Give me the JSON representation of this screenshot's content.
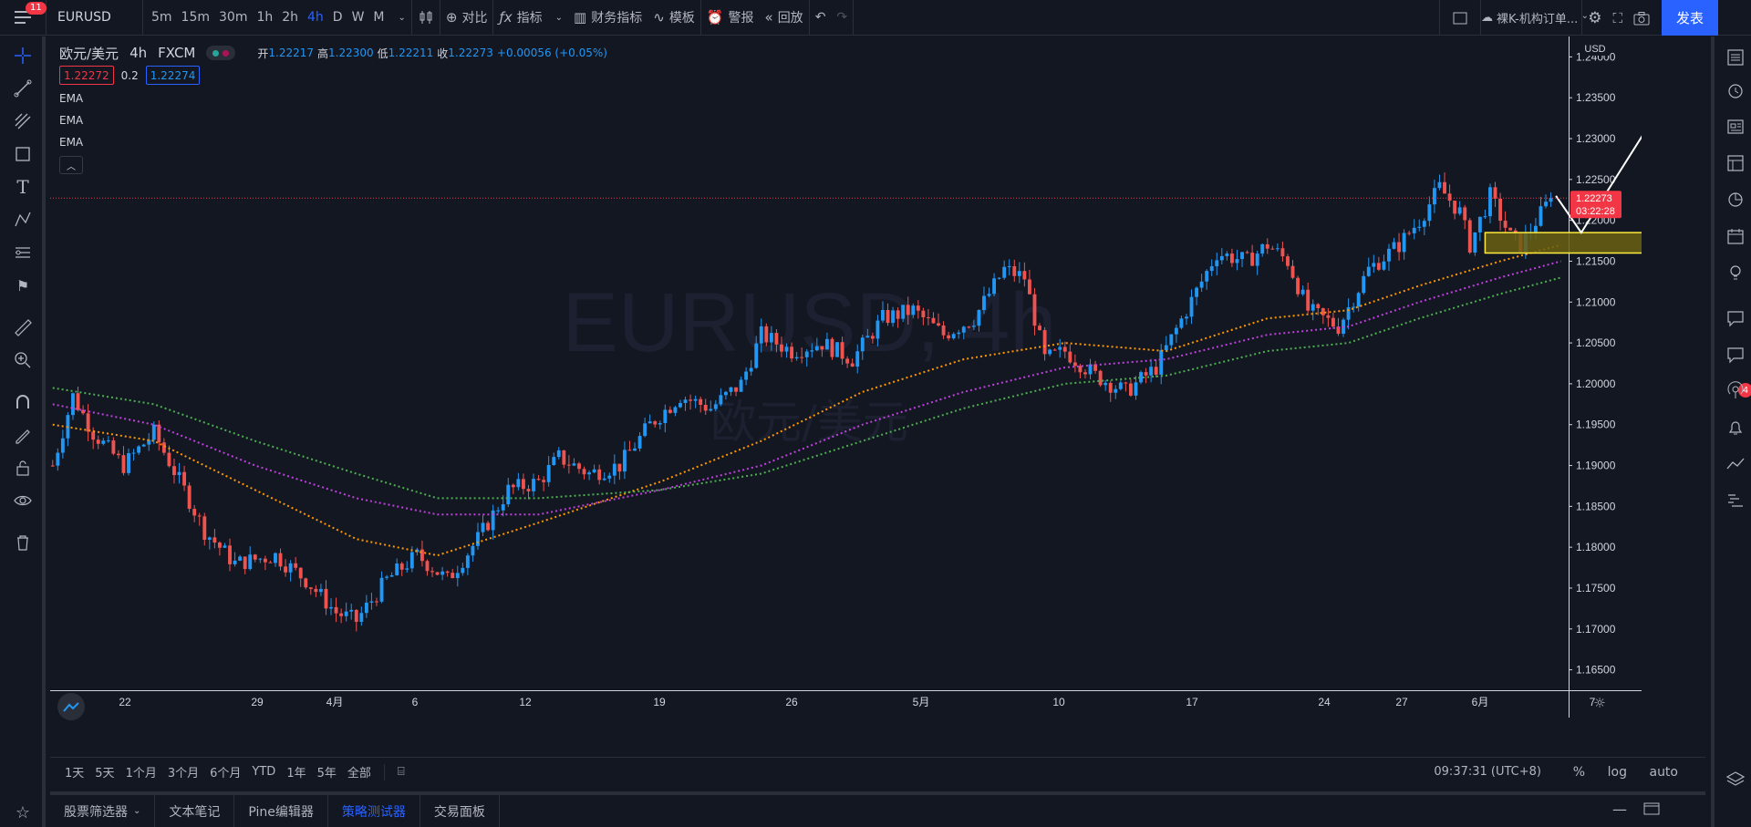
{
  "topbar": {
    "menu_badge": "11",
    "symbol": "EURUSD",
    "intervals": [
      "5m",
      "15m",
      "30m",
      "1h",
      "2h",
      "4h",
      "D",
      "W",
      "M"
    ],
    "active_interval": "4h",
    "compare_label": "对比",
    "indicators_label": "指标",
    "financials_label": "财务指标",
    "templates_label": "模板",
    "alert_label": "警报",
    "replay_label": "回放",
    "layout_name": "裸K-机构订单...",
    "publish_label": "发表"
  },
  "legend": {
    "title": "欧元/美元",
    "interval": "4h",
    "exchange": "FXCM",
    "open_label": "开",
    "open": "1.22217",
    "high_label": "高",
    "high": "1.22300",
    "low_label": "低",
    "low": "1.22211",
    "close_label": "收",
    "close": "1.22273",
    "change": "+0.00056 (+0.05%)",
    "bid": "1.22272",
    "spread": "0.2",
    "ask": "1.22274",
    "indicators": [
      "EMA",
      "EMA",
      "EMA"
    ]
  },
  "watermark": {
    "symbol": "EURUSD, 4h",
    "description": "欧元/美元"
  },
  "price_axis": {
    "currency": "USD",
    "ticks": [
      "1.24000",
      "1.23500",
      "1.23000",
      "1.22500",
      "1.22000",
      "1.21500",
      "1.21000",
      "1.20500",
      "1.20000",
      "1.19500",
      "1.19000",
      "1.18500",
      "1.18000",
      "1.17500",
      "1.17000",
      "1.16500"
    ],
    "last_price": "1.22273",
    "countdown": "03:22:28"
  },
  "time_axis": {
    "ticks": [
      "22",
      "29",
      "4月",
      "6",
      "12",
      "19",
      "26",
      "5月",
      "10",
      "17",
      "24",
      "27",
      "6月",
      "7"
    ]
  },
  "range_bar": {
    "ranges": [
      "1天",
      "5天",
      "1个月",
      "3个月",
      "6个月",
      "YTD",
      "1年",
      "5年",
      "全部"
    ],
    "time": "09:37:31 (UTC+8)",
    "percent": "%",
    "log": "log",
    "auto": "auto"
  },
  "bottom_tabs": [
    "股票筛选器",
    "文本笔记",
    "Pine编辑器",
    "策略测试器",
    "交易面板"
  ],
  "active_bottom_tab": "策略测试器",
  "right_badge": "4",
  "colors": {
    "background": "#131722",
    "up": "#2196f3",
    "down": "#ef5350",
    "ema_fast": "#ff9800",
    "ema_mid": "#c040e0",
    "ema_slow": "#4caf50",
    "zone_fill": "#6a6010",
    "zone_border": "#ffeb3b",
    "accent": "#2962ff",
    "price_tag": "#f23645"
  },
  "chart_data": {
    "type": "candlestick",
    "symbol": "EURUSD",
    "interval": "4h",
    "ylim": [
      1.1625,
      1.2425
    ],
    "x_labels": [
      "22",
      "29",
      "4月",
      "6",
      "12",
      "19",
      "26",
      "5月",
      "10",
      "17",
      "24",
      "27",
      "6月",
      "7"
    ],
    "close_path": [
      [
        0,
        1.19
      ],
      [
        4,
        1.1985
      ],
      [
        8,
        1.194
      ],
      [
        14,
        1.19
      ],
      [
        20,
        1.194
      ],
      [
        26,
        1.187
      ],
      [
        30,
        1.182
      ],
      [
        36,
        1.178
      ],
      [
        44,
        1.179
      ],
      [
        50,
        1.176
      ],
      [
        56,
        1.172
      ],
      [
        60,
        1.171
      ],
      [
        66,
        1.176
      ],
      [
        72,
        1.179
      ],
      [
        78,
        1.176
      ],
      [
        84,
        1.181
      ],
      [
        90,
        1.187
      ],
      [
        96,
        1.188
      ],
      [
        100,
        1.191
      ],
      [
        106,
        1.189
      ],
      [
        112,
        1.19
      ],
      [
        118,
        1.195
      ],
      [
        124,
        1.1985
      ],
      [
        130,
        1.197
      ],
      [
        136,
        1.2
      ],
      [
        140,
        1.206
      ],
      [
        146,
        1.204
      ],
      [
        152,
        1.205
      ],
      [
        158,
        1.203
      ],
      [
        164,
        1.208
      ],
      [
        170,
        1.209
      ],
      [
        176,
        1.206
      ],
      [
        182,
        1.208
      ],
      [
        188,
        1.214
      ],
      [
        192,
        1.213
      ],
      [
        196,
        1.203
      ],
      [
        200,
        1.204
      ],
      [
        206,
        1.201
      ],
      [
        212,
        1.199
      ],
      [
        218,
        1.202
      ],
      [
        224,
        1.209
      ],
      [
        230,
        1.216
      ],
      [
        236,
        1.215
      ],
      [
        240,
        1.217
      ],
      [
        244,
        1.215
      ],
      [
        248,
        1.209
      ],
      [
        254,
        1.207
      ],
      [
        260,
        1.214
      ],
      [
        266,
        1.217
      ],
      [
        270,
        1.22
      ],
      [
        274,
        1.224
      ],
      [
        278,
        1.221
      ],
      [
        280,
        1.217
      ],
      [
        284,
        1.223
      ],
      [
        288,
        1.218
      ],
      [
        290,
        1.217
      ],
      [
        296,
        1.2227
      ]
    ],
    "ema": [
      {
        "color": "#ff9800",
        "points": [
          [
            0,
            1.195
          ],
          [
            20,
            1.193
          ],
          [
            40,
            1.187
          ],
          [
            60,
            1.181
          ],
          [
            76,
            1.179
          ],
          [
            96,
            1.183
          ],
          [
            120,
            1.188
          ],
          [
            140,
            1.193
          ],
          [
            160,
            1.199
          ],
          [
            180,
            1.203
          ],
          [
            200,
            1.205
          ],
          [
            220,
            1.204
          ],
          [
            240,
            1.208
          ],
          [
            256,
            1.209
          ],
          [
            270,
            1.212
          ],
          [
            286,
            1.215
          ],
          [
            298,
            1.217
          ]
        ]
      },
      {
        "color": "#c040e0",
        "points": [
          [
            0,
            1.1975
          ],
          [
            20,
            1.195
          ],
          [
            40,
            1.19
          ],
          [
            60,
            1.186
          ],
          [
            76,
            1.184
          ],
          [
            96,
            1.184
          ],
          [
            120,
            1.187
          ],
          [
            140,
            1.19
          ],
          [
            160,
            1.195
          ],
          [
            180,
            1.199
          ],
          [
            200,
            1.202
          ],
          [
            220,
            1.203
          ],
          [
            240,
            1.206
          ],
          [
            256,
            1.207
          ],
          [
            270,
            1.21
          ],
          [
            286,
            1.213
          ],
          [
            298,
            1.215
          ]
        ]
      },
      {
        "color": "#4caf50",
        "points": [
          [
            0,
            1.1995
          ],
          [
            20,
            1.1975
          ],
          [
            40,
            1.193
          ],
          [
            60,
            1.189
          ],
          [
            76,
            1.186
          ],
          [
            96,
            1.186
          ],
          [
            120,
            1.187
          ],
          [
            140,
            1.189
          ],
          [
            160,
            1.193
          ],
          [
            180,
            1.197
          ],
          [
            200,
            1.2
          ],
          [
            220,
            1.201
          ],
          [
            240,
            1.204
          ],
          [
            256,
            1.205
          ],
          [
            270,
            1.208
          ],
          [
            286,
            1.211
          ],
          [
            298,
            1.213
          ]
        ]
      }
    ],
    "zone": {
      "y_top": 1.2185,
      "y_bottom": 1.216
    },
    "last_price": 1.22273
  }
}
